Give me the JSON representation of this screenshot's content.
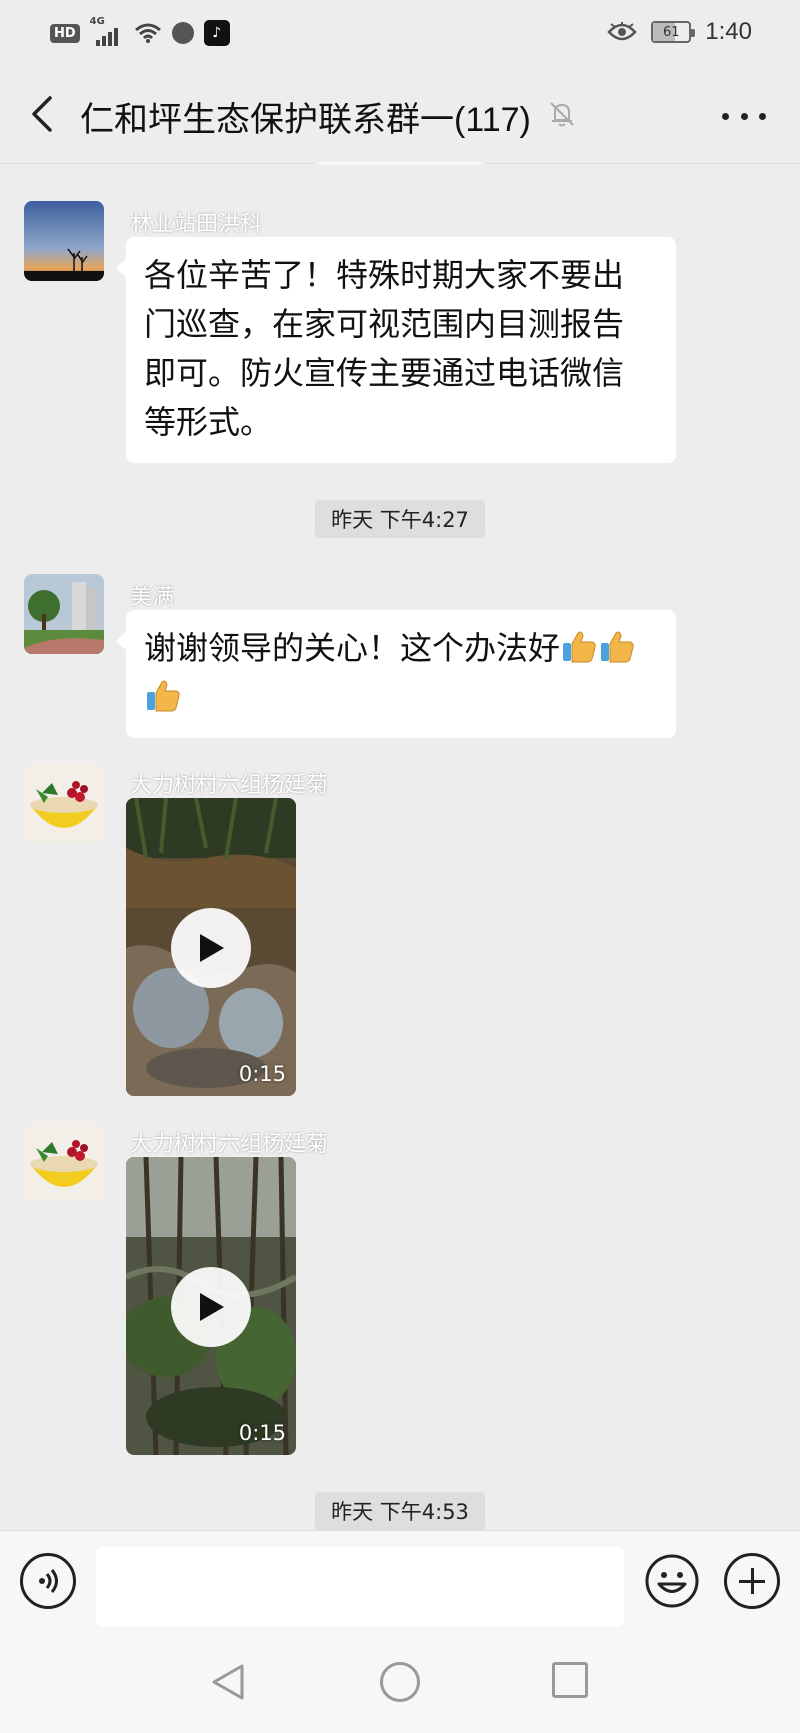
{
  "status_bar": {
    "hd_badge": "HD",
    "network": "4G",
    "app_badge_icon": "tiktok-icon",
    "battery_percent": 61,
    "battery_label": "61",
    "time": "1:40"
  },
  "header": {
    "back_icon": "chevron-left-icon",
    "title": "仁和坪生态保护联系群一(117)",
    "mute_icon": "bell-muted-icon",
    "more_icon": "more-dots-icon"
  },
  "messages": [
    {
      "type": "text",
      "sender": "林业站田洪科",
      "avatar_icon": "sunset-avatar",
      "lines": [
        "各位辛苦了！特殊时期大家不要出",
        "门巡查，在家可视范围内目测报告",
        "即可。防火宣传主要通过电话微信",
        "等形式。"
      ]
    },
    {
      "type": "time",
      "text": "昨天 下午4:27"
    },
    {
      "type": "text",
      "sender": "美满",
      "avatar_icon": "park-avatar",
      "text": "谢谢领导的关心！这个办法好",
      "emoji": "thumbs-up-icon",
      "emoji_count": 3
    },
    {
      "type": "video",
      "sender": "大力树村六组杨廷菊",
      "avatar_icon": "fruit-bowl-avatar",
      "duration": "0:15"
    },
    {
      "type": "video",
      "sender": "大力树村六组杨廷菊",
      "avatar_icon": "fruit-bowl-avatar",
      "duration": "0:15"
    },
    {
      "type": "time",
      "text": "昨天 下午4:53"
    }
  ],
  "input_bar": {
    "voice_icon": "voice-icon",
    "input_value": "",
    "emoji_icon": "smiley-icon",
    "plus_icon": "plus-circle-icon"
  },
  "nav_bar": {
    "back_icon": "nav-back-icon",
    "home_icon": "nav-home-icon",
    "recent_icon": "nav-recent-icon"
  },
  "colors": {
    "chat_background": "#ededed",
    "bubble": "#ffffff",
    "timestamp_bg": "#dedede"
  }
}
